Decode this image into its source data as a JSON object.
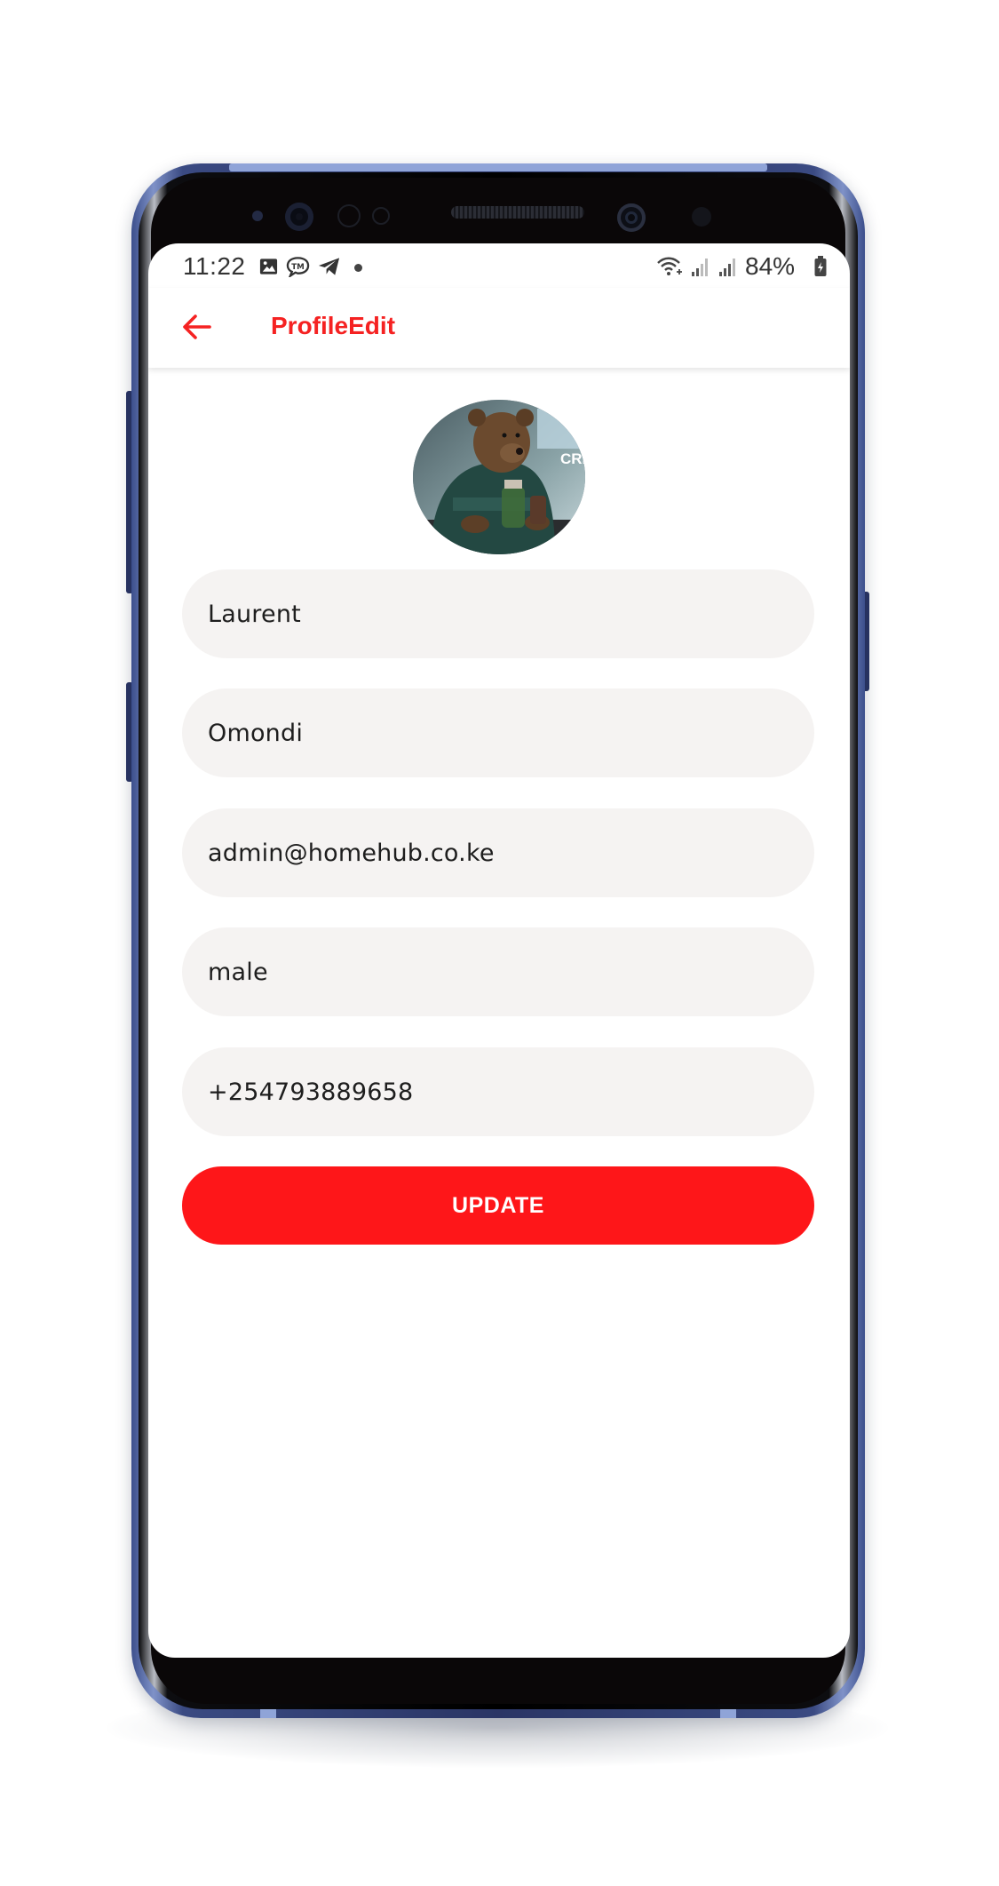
{
  "status_bar": {
    "time": "11:22",
    "battery": "84%",
    "icons": [
      "image-icon",
      "tm-icon",
      "telegram-icon",
      "dot-icon",
      "wifi-icon",
      "signal-icon",
      "signal-icon",
      "battery-icon"
    ]
  },
  "app_bar": {
    "title": "ProfileEdit",
    "back_icon": "arrow-left-icon"
  },
  "profile": {
    "avatar_text": "CREA"
  },
  "form": {
    "first_name": "Laurent",
    "last_name": "Omondi",
    "email": "admin@homehub.co.ke",
    "gender": "male",
    "phone": "+254793889658",
    "submit_label": "UPDATE"
  },
  "colors": {
    "accent": "#f52222",
    "button": "#fe1619",
    "field_bg": "#f5f3f2",
    "phone_frame": "#2a3565"
  }
}
